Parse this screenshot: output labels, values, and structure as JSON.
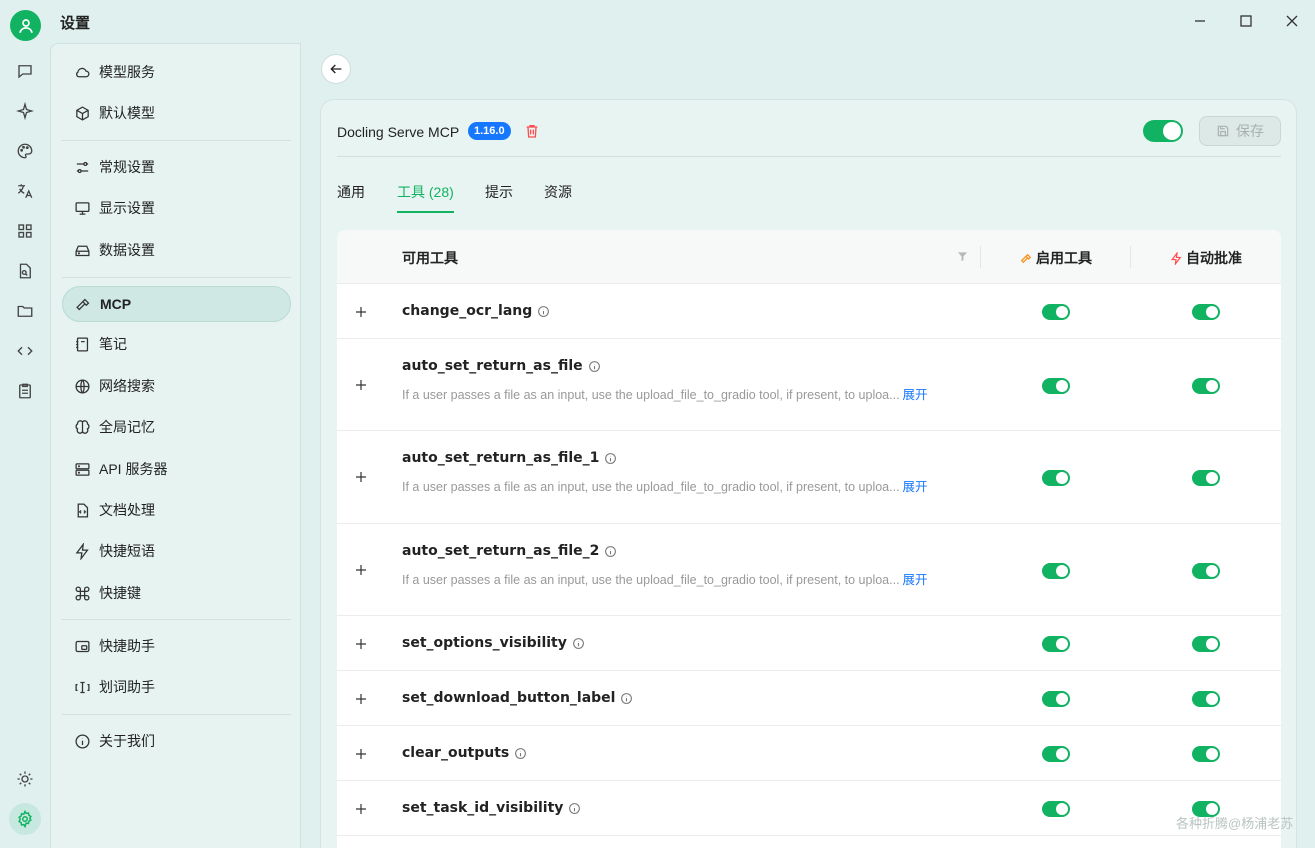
{
  "window": {
    "title": "设置"
  },
  "sidebar": {
    "items": [
      {
        "label": "模型服务",
        "icon": "cloud-icon"
      },
      {
        "label": "默认模型",
        "icon": "cube-icon"
      },
      {
        "label": "常规设置",
        "icon": "sliders-icon"
      },
      {
        "label": "显示设置",
        "icon": "monitor-icon"
      },
      {
        "label": "数据设置",
        "icon": "drive-icon"
      },
      {
        "label": "MCP",
        "icon": "hammer-icon",
        "active": true
      },
      {
        "label": "笔记",
        "icon": "notebook-icon"
      },
      {
        "label": "网络搜索",
        "icon": "globe-icon"
      },
      {
        "label": "全局记忆",
        "icon": "brain-icon"
      },
      {
        "label": "API 服务器",
        "icon": "server-icon"
      },
      {
        "label": "文档处理",
        "icon": "file-code-icon"
      },
      {
        "label": "快捷短语",
        "icon": "zap-icon"
      },
      {
        "label": "快捷键",
        "icon": "command-icon"
      },
      {
        "label": "快捷助手",
        "icon": "app-window-icon"
      },
      {
        "label": "划词助手",
        "icon": "text-select-icon"
      },
      {
        "label": "关于我们",
        "icon": "info-icon"
      }
    ]
  },
  "server": {
    "name": "Docling Serve MCP",
    "version": "1.16.0",
    "enabled": true,
    "save_label": "保存"
  },
  "tabs": [
    {
      "label": "通用"
    },
    {
      "label": "工具 (28)",
      "active": true
    },
    {
      "label": "提示"
    },
    {
      "label": "资源"
    }
  ],
  "table": {
    "headers": {
      "tool": "可用工具",
      "enable": "启用工具",
      "auto_approve": "自动批准"
    },
    "expand_label": "展开",
    "rows": [
      {
        "name": "change_ocr_lang",
        "desc": "",
        "enabled": true,
        "auto": true
      },
      {
        "name": "auto_set_return_as_file",
        "desc": "If a user passes a file as an input, use the upload_file_to_gradio tool, if present, to uploa...",
        "enabled": true,
        "auto": true
      },
      {
        "name": "auto_set_return_as_file_1",
        "desc": "If a user passes a file as an input, use the upload_file_to_gradio tool, if present, to uploa...",
        "enabled": true,
        "auto": true
      },
      {
        "name": "auto_set_return_as_file_2",
        "desc": "If a user passes a file as an input, use the upload_file_to_gradio tool, if present, to uploa...",
        "enabled": true,
        "auto": true
      },
      {
        "name": "set_options_visibility",
        "desc": "",
        "enabled": true,
        "auto": true
      },
      {
        "name": "set_download_button_label",
        "desc": "",
        "enabled": true,
        "auto": true
      },
      {
        "name": "clear_outputs",
        "desc": "",
        "enabled": true,
        "auto": true
      },
      {
        "name": "set_task_id_visibility",
        "desc": "",
        "enabled": true,
        "auto": true
      }
    ]
  },
  "watermark": "各种折腾@杨浦老苏",
  "colors": {
    "accent": "#12b263",
    "badge": "#1677ff",
    "danger": "#ff4d4f",
    "hammer": "#fa8c16"
  }
}
